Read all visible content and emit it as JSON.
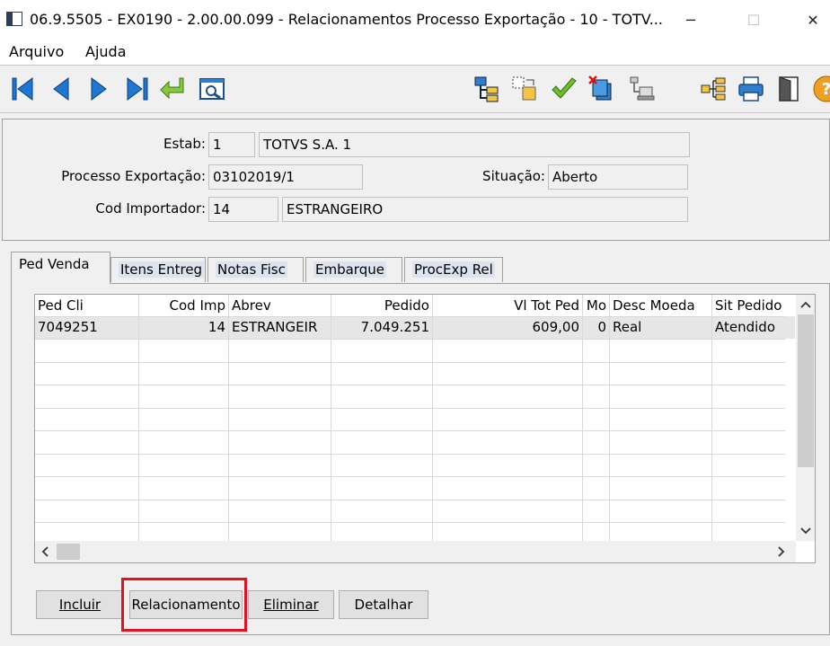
{
  "window": {
    "title": "06.9.5505 - EX0190 - 2.00.00.099 - Relacionamentos Processo Exportação - 10 - TOTV...",
    "minimize": "─",
    "maximize": "☐",
    "close": "✕"
  },
  "menu": [
    "Arquivo",
    "Ajuda"
  ],
  "toolbar": {
    "icons": [
      "first-record-icon",
      "previous-record-icon",
      "next-record-icon",
      "last-record-icon",
      "goto-icon",
      "search-icon",
      "hierarchy-icon",
      "copy-icon",
      "check-icon",
      "multi-doc-icon",
      "network-icon",
      "tree-icon",
      "print-icon",
      "exit-door-icon",
      "help-icon"
    ]
  },
  "header": {
    "estab_label": "Estab:",
    "estab_code": "1",
    "estab_name": "TOTVS S.A. 1",
    "processo_label": "Processo Exportação:",
    "processo_value": "03102019/1",
    "situacao_label": "Situação:",
    "situacao_value": "Aberto",
    "importador_label": "Cod Importador:",
    "importador_code": "14",
    "importador_name": "ESTRANGEIRO"
  },
  "tabs": [
    "Ped Venda",
    "Itens Entreg",
    "Notas Fisc",
    "Embarque",
    "ProcExp Rel"
  ],
  "grid": {
    "columns": [
      "Ped Cli",
      "Cod Imp",
      "Abrev",
      "Pedido",
      "Vl Tot Ped",
      "Mo",
      "Desc Moeda",
      "Sit Pedido"
    ],
    "rows": [
      [
        "7049251",
        "14",
        "ESTRANGEIR",
        "7.049.251",
        "609,00",
        "0",
        "Real",
        "Atendido"
      ]
    ]
  },
  "buttons": {
    "incluir": "Incluir",
    "relacionamento": "Relacionamento",
    "eliminar": "Eliminar",
    "detalhar": "Detalhar"
  },
  "colors": {
    "highlight_box": "#e0141e",
    "row_selected": "#e6e6e6",
    "icon_blue": "#1e78d2"
  }
}
